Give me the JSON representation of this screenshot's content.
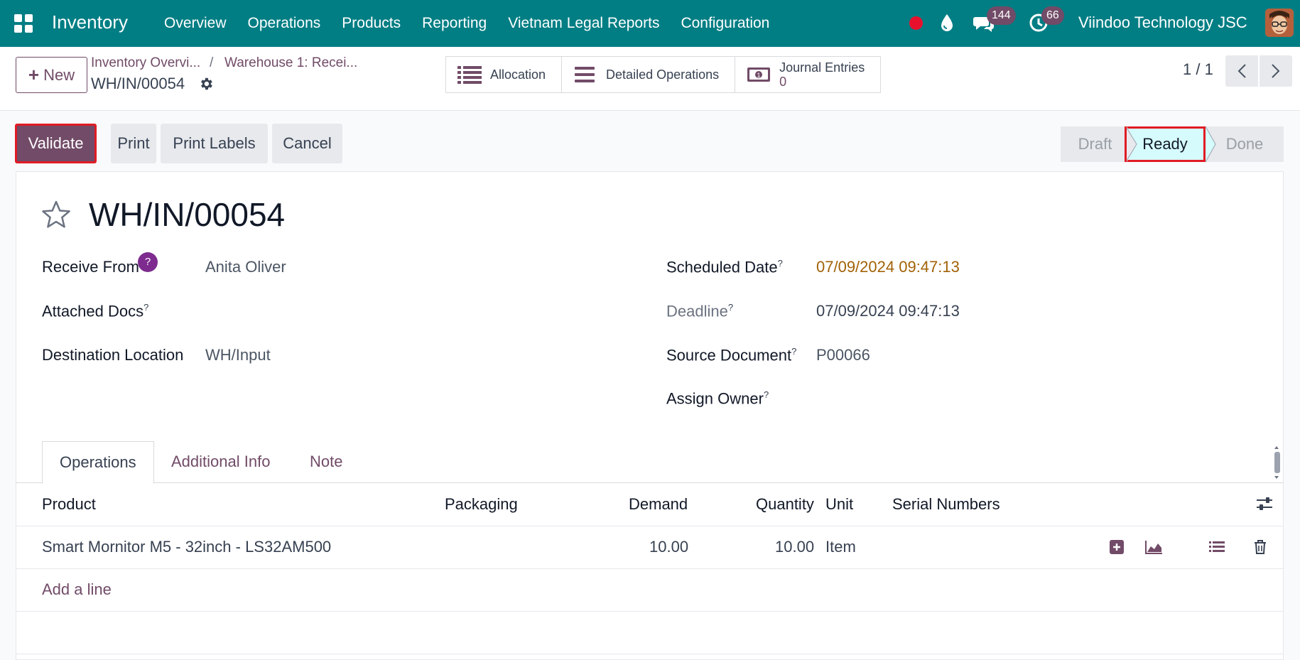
{
  "navbar": {
    "brand": "Inventory",
    "menu": [
      "Overview",
      "Operations",
      "Products",
      "Reporting",
      "Vietnam Legal Reports",
      "Configuration"
    ],
    "chat_count": "144",
    "activity_count": "66",
    "company": "Viindoo Technology JSC",
    "icons": [
      "apps-icon",
      "record-dot-icon",
      "drop-icon",
      "chat-icon",
      "clock-icon",
      "avatar"
    ]
  },
  "control": {
    "new_label": "New",
    "breadcrumb": [
      "Inventory Overvi...",
      "Warehouse 1: Recei..."
    ],
    "current": "WH/IN/00054",
    "smart_buttons": {
      "allocation": "Allocation",
      "detailed_operations": "Detailed Operations",
      "journal_entries": "Journal Entries",
      "journal_entries_count": "0"
    },
    "pager": "1 / 1"
  },
  "actions": {
    "validate": "Validate",
    "print": "Print",
    "print_labels": "Print Labels",
    "cancel": "Cancel"
  },
  "status": {
    "stages": [
      "Draft",
      "Ready",
      "Done"
    ],
    "current": "Ready"
  },
  "form": {
    "title": "WH/IN/00054",
    "receive_from_label": "Receive From",
    "receive_from_help": "?",
    "receive_from": "Anita Oliver",
    "attached_docs_label": "Attached Docs",
    "destination_label": "Destination Location",
    "destination": "WH/Input",
    "scheduled_label": "Scheduled Date",
    "scheduled": "07/09/2024 09:47:13",
    "deadline_label": "Deadline",
    "deadline": "07/09/2024 09:47:13",
    "source_label": "Source Document",
    "source": "P00066",
    "owner_label": "Assign Owner",
    "tooltip_mark": "?"
  },
  "tabs": [
    "Operations",
    "Additional Info",
    "Note"
  ],
  "table": {
    "headers": [
      "Product",
      "Packaging",
      "Demand",
      "Quantity",
      "Unit",
      "Serial Numbers"
    ],
    "rows": [
      {
        "product": "Smart Mornitor M5 - 32inch - LS32AM500",
        "packaging": "",
        "demand": "10.00",
        "quantity": "10.00",
        "unit": "Item",
        "serials": ""
      }
    ],
    "add_line": "Add a line"
  },
  "colors": {
    "navbar": "#017e84",
    "primary": "#714b67",
    "highlight_border": "#e01b24",
    "ready_bg": "#d5fbfc"
  }
}
